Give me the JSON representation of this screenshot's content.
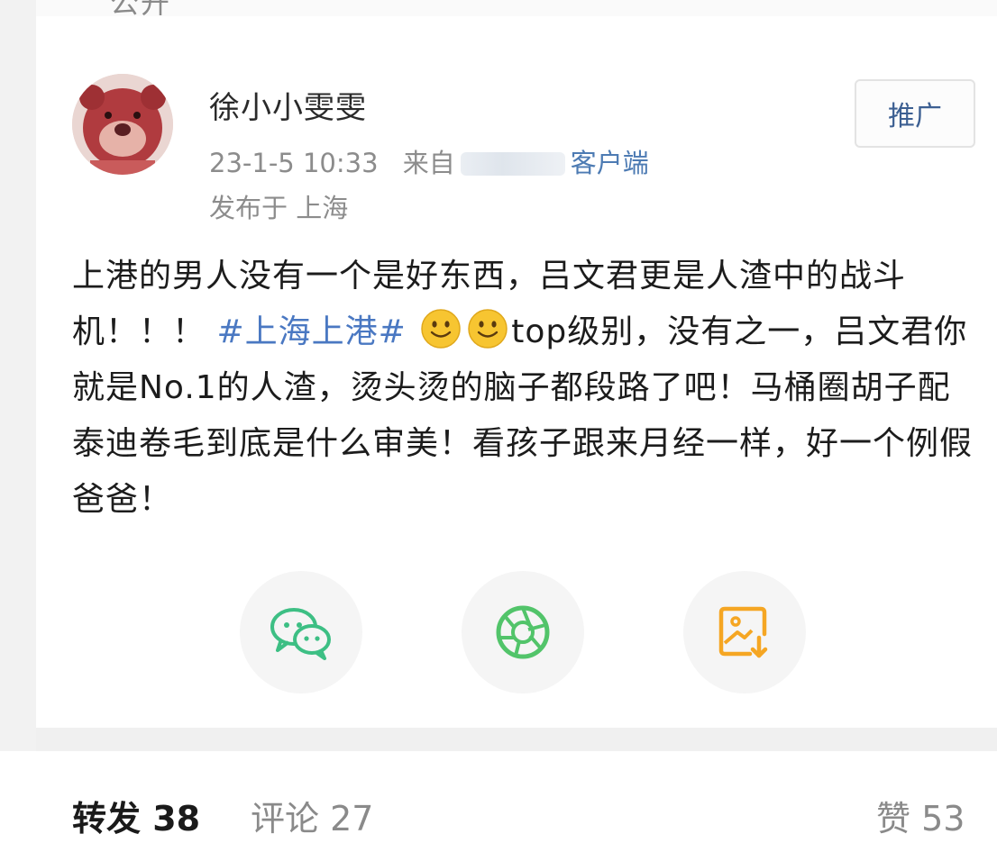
{
  "top_strip": {
    "partial_text": "公开"
  },
  "author": {
    "name": "徐小小雯雯"
  },
  "post_meta": {
    "time": "23-1-5 10:33",
    "from_label": "来自",
    "client_suffix": "客户端",
    "location": "发布于 上海"
  },
  "promote_button": {
    "label": "推广"
  },
  "post": {
    "text_part1": "上港的男人没有一个是好东西，吕文君更是人渣中的战斗机！！！",
    "hashtag": "#上海上港#",
    "text_part2": "top级别，没有之一，吕文君你就是No.1的人渣，烫头烫的脑子都段路了吧！马桶圈胡子配泰迪卷毛到底是什么审美！看孩子跟来月经一样，好一个例假爸爸！"
  },
  "share_actions": [
    {
      "icon": "wechat-icon",
      "color": "#3dbf84"
    },
    {
      "icon": "moments-icon",
      "color": "#52c46a"
    },
    {
      "icon": "save-image-icon",
      "color": "#f5a623"
    }
  ],
  "stats": {
    "forward": "转发 38",
    "comment": "评论 27",
    "like": "赞 53"
  }
}
